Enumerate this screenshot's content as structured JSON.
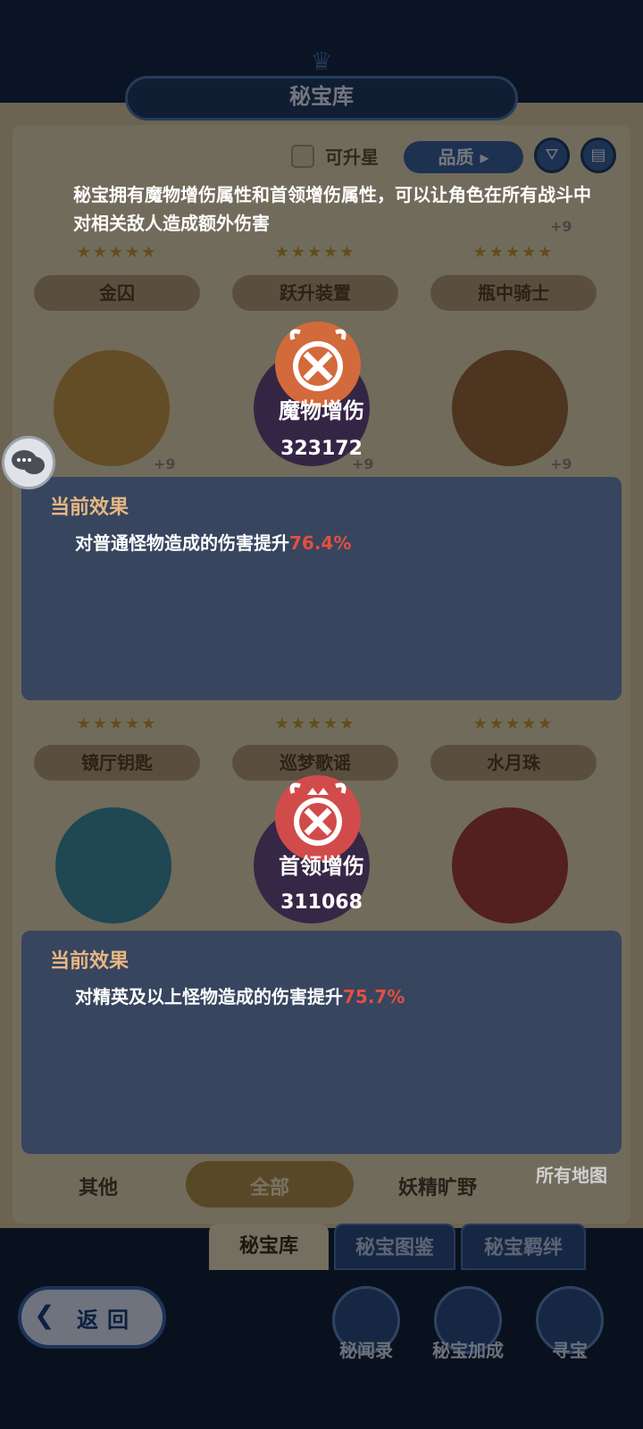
{
  "header": {
    "title": "秘宝库",
    "filter_checkbox_label": "可升星",
    "sort_label": "品质"
  },
  "grid": {
    "row1": [
      {
        "name": "金囚"
      },
      {
        "name": "跃升装置"
      },
      {
        "name": "瓶中骑士"
      }
    ],
    "row2_levels": [
      "+9",
      "+9",
      "+9"
    ],
    "row3": [
      {
        "name": "镜厅钥匙"
      },
      {
        "name": "巡梦歌谣"
      },
      {
        "name": "水月珠"
      }
    ]
  },
  "tabs": {
    "left": "其他",
    "active": "全部",
    "right": "妖精旷野",
    "map": "所有地图"
  },
  "bottom": {
    "tabs": [
      "秘宝库",
      "秘宝图鉴",
      "秘宝羁绊"
    ],
    "icons": [
      "秘闻录",
      "秘宝加成",
      "寻宝"
    ],
    "back_label": "返回"
  },
  "dialog": {
    "intro": "秘宝拥有魔物增伤属性和首领增伤属性，可以让角色在所有战斗中对相关敌人造成额外伤害",
    "monster": {
      "name": "魔物增伤",
      "value": "323172",
      "effect_title": "当前效果",
      "effect_text": "对普通怪物造成的伤害提升",
      "effect_pct": "76.4%"
    },
    "boss": {
      "name": "首领增伤",
      "value": "311068",
      "effect_title": "当前效果",
      "effect_text": "对精英及以上怪物造成的伤害提升",
      "effect_pct": "75.7%"
    }
  },
  "colors": {
    "accent_pct": "#e3503d",
    "effect_title": "#e6b783",
    "monster_badge": "#d26a3b",
    "boss_badge": "#d24b4b"
  }
}
